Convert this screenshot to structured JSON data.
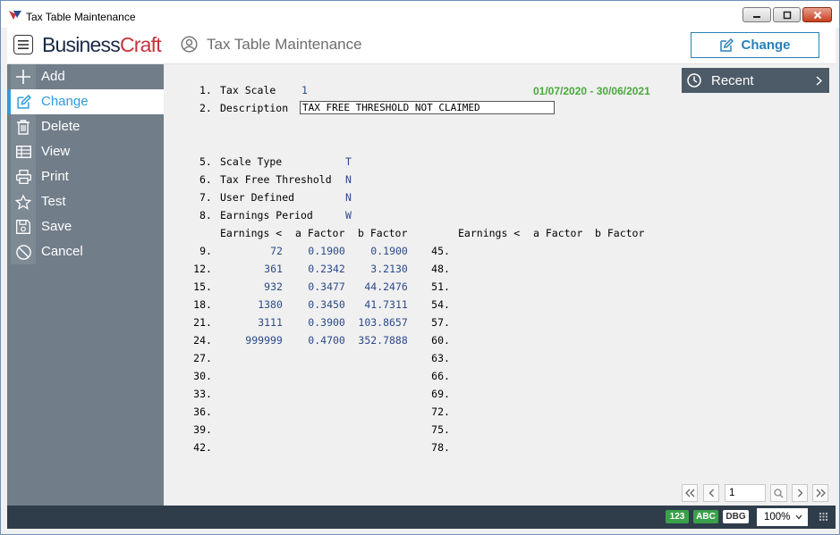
{
  "window": {
    "title": "Tax Table Maintenance"
  },
  "header": {
    "brand_a": "Business",
    "brand_b": "Craft",
    "page_title": "Tax Table Maintenance",
    "mode_button": "Change"
  },
  "sidebar": {
    "items": [
      {
        "label": "Add",
        "icon": "plus-icon"
      },
      {
        "label": "Change",
        "icon": "edit-icon"
      },
      {
        "label": "Delete",
        "icon": "trash-icon"
      },
      {
        "label": "View",
        "icon": "table-icon"
      },
      {
        "label": "Print",
        "icon": "printer-icon"
      },
      {
        "label": "Test",
        "icon": "star-icon"
      },
      {
        "label": "Save",
        "icon": "save-icon"
      },
      {
        "label": "Cancel",
        "icon": "cancel-icon"
      }
    ]
  },
  "recent": {
    "label": "Recent"
  },
  "form": {
    "date_range": "01/07/2020 - 30/06/2021",
    "tax_scale": {
      "num": "1.",
      "label": "Tax Scale",
      "value": "1"
    },
    "description": {
      "num": "2.",
      "label": "Description",
      "value": "TAX FREE THRESHOLD NOT CLAIMED"
    },
    "scale_type": {
      "num": "5.",
      "label": "Scale Type",
      "value": "T"
    },
    "tax_free_threshold": {
      "num": "6.",
      "label": "Tax Free Threshold",
      "value": "N"
    },
    "user_defined": {
      "num": "7.",
      "label": "User Defined",
      "value": "N"
    },
    "earnings_period": {
      "num": "8.",
      "label": "Earnings Period",
      "value": "W"
    }
  },
  "table": {
    "headers": [
      "Earnings <",
      "a Factor",
      "b Factor"
    ],
    "left_rows": [
      {
        "num": "9.",
        "earnings": "72",
        "a": "0.1900",
        "b": "0.1900"
      },
      {
        "num": "12.",
        "earnings": "361",
        "a": "0.2342",
        "b": "3.2130"
      },
      {
        "num": "15.",
        "earnings": "932",
        "a": "0.3477",
        "b": "44.2476"
      },
      {
        "num": "18.",
        "earnings": "1380",
        "a": "0.3450",
        "b": "41.7311"
      },
      {
        "num": "21.",
        "earnings": "3111",
        "a": "0.3900",
        "b": "103.8657"
      },
      {
        "num": "24.",
        "earnings": "999999",
        "a": "0.4700",
        "b": "352.7888"
      },
      {
        "num": "27.",
        "earnings": "",
        "a": "",
        "b": ""
      },
      {
        "num": "30.",
        "earnings": "",
        "a": "",
        "b": ""
      },
      {
        "num": "33.",
        "earnings": "",
        "a": "",
        "b": ""
      },
      {
        "num": "36.",
        "earnings": "",
        "a": "",
        "b": ""
      },
      {
        "num": "39.",
        "earnings": "",
        "a": "",
        "b": ""
      },
      {
        "num": "42.",
        "earnings": "",
        "a": "",
        "b": ""
      }
    ],
    "right_rows": [
      {
        "num": "45."
      },
      {
        "num": "48."
      },
      {
        "num": "51."
      },
      {
        "num": "54."
      },
      {
        "num": "57."
      },
      {
        "num": "60."
      },
      {
        "num": "63."
      },
      {
        "num": "66."
      },
      {
        "num": "69."
      },
      {
        "num": "72."
      },
      {
        "num": "75."
      },
      {
        "num": "78."
      }
    ]
  },
  "pager": {
    "page": "1"
  },
  "statusbar": {
    "badge_num": "123",
    "badge_abc": "ABC",
    "badge_dbg": "DBG",
    "zoom": "100%"
  }
}
